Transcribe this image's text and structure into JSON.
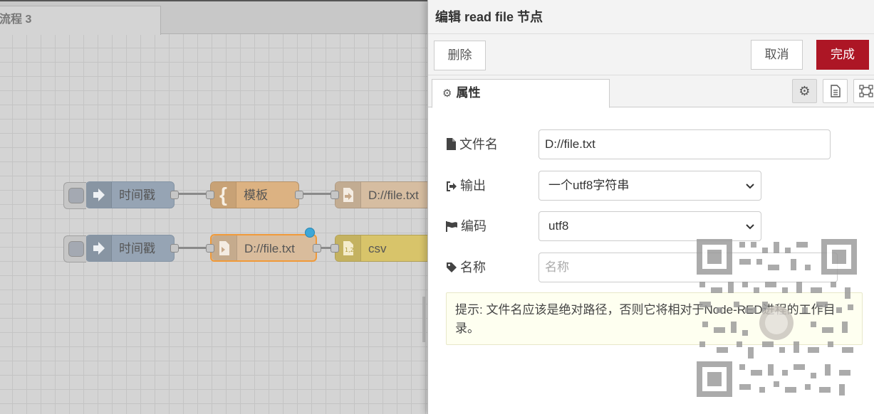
{
  "workspace": {
    "flow_tab_label": "流程 3",
    "nodes": [
      {
        "type": "inject",
        "label": "时间戳",
        "icon": "inject-arrow-icon"
      },
      {
        "type": "template",
        "label": "模板",
        "icon": "template-brace-icon"
      },
      {
        "type": "file-out",
        "label": "D://file.txt",
        "icon": "file-out-icon"
      },
      {
        "type": "inject",
        "label": "时间戳",
        "icon": "inject-arrow-icon"
      },
      {
        "type": "file-in",
        "label": "D://file.txt",
        "icon": "file-in-icon"
      },
      {
        "type": "csv",
        "label": "csv",
        "icon": "csv-icon"
      }
    ],
    "colors": {
      "inject": "#96a4b4",
      "template": "#dcb282",
      "file": "#d6bda1",
      "csv": "#d8c46a",
      "status_dot": "#3da7d8",
      "selection": "#f09a3a"
    }
  },
  "editor": {
    "title": "编辑 read file 节点",
    "buttons": {
      "delete": "删除",
      "cancel": "取消",
      "done": "完成"
    },
    "done_color": "#ad1625",
    "tab_properties": "属性",
    "tab_icons": [
      "gear-icon",
      "description-icon",
      "appearance-icon"
    ],
    "fields": {
      "filename": {
        "label": "文件名",
        "value": "D://file.txt",
        "icon": "file-icon"
      },
      "output": {
        "label": "输出",
        "value": "一个utf8字符串",
        "icon": "sign-out-icon"
      },
      "encoding": {
        "label": "编码",
        "value": "utf8",
        "icon": "flag-icon"
      },
      "name": {
        "label": "名称",
        "placeholder": "名称",
        "icon": "tag-icon"
      }
    },
    "tip": "提示: 文件名应该是绝对路径，否则它将相对于Node-RED进程的工作目录。"
  }
}
